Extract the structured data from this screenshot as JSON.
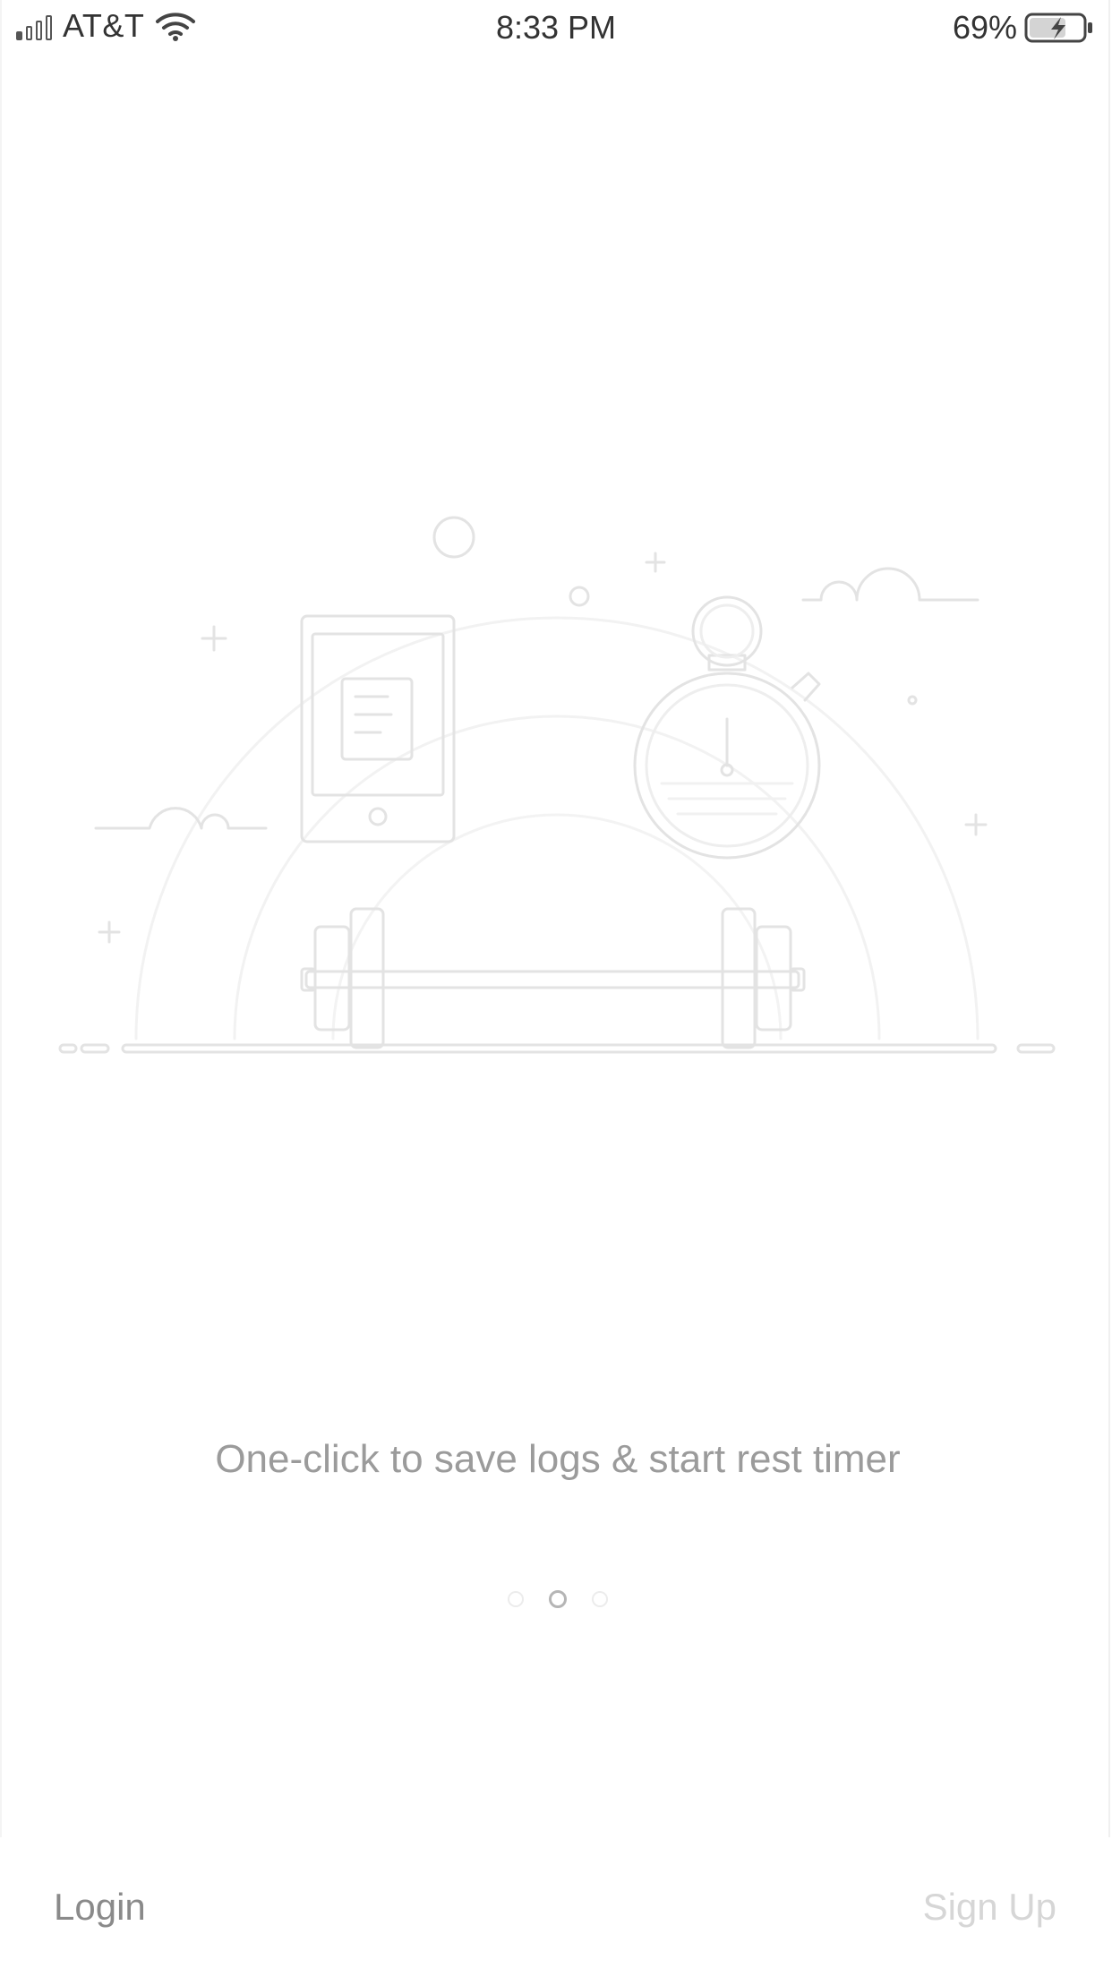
{
  "status_bar": {
    "carrier": "AT&T",
    "time": "8:33 PM",
    "battery_percent": "69%",
    "signal_bars_active": 1,
    "signal_bars_total": 4,
    "battery_level": 0.69,
    "charging": true
  },
  "onboarding": {
    "caption": "One-click to save logs & start rest timer",
    "page_count": 3,
    "current_page": 2
  },
  "bottom_bar": {
    "login_label": "Login",
    "signup_label": "Sign Up"
  },
  "icons": {
    "signal": "cellular-signal-icon",
    "wifi": "wifi-icon",
    "battery": "battery-charging-icon",
    "illustration": "workout-illustration"
  },
  "colors": {
    "caption": "#9b9b9b",
    "login": "#8a8a8a",
    "signup": "#d6d6d6",
    "line_art": "#e6e6e6"
  }
}
